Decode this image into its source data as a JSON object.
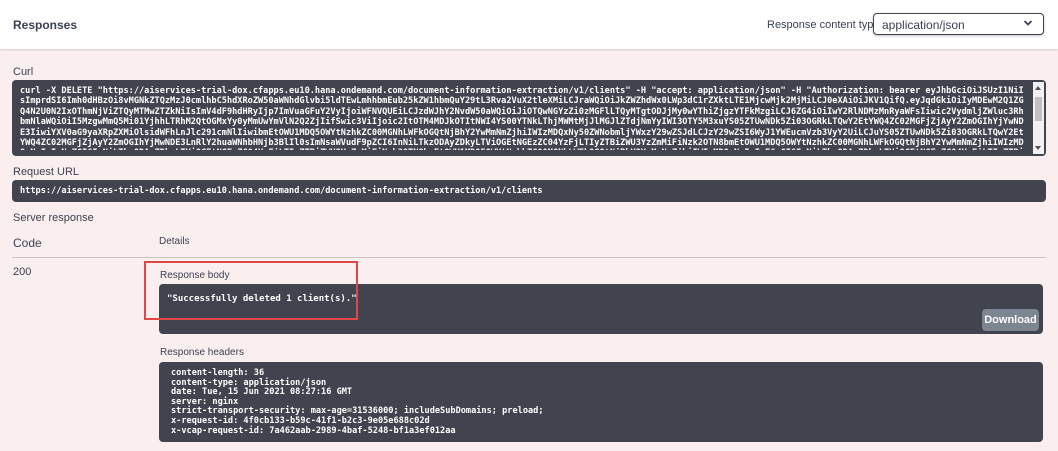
{
  "header": {
    "title": "Responses",
    "content_type_label": "Response content type",
    "content_type_value": "application/json"
  },
  "curl": {
    "label": "Curl",
    "command": "curl -X DELETE \"https://aiservices-trial-dox.cfapps.eu10.hana.ondemand.com/document-information-extraction/v1/clients\" -H \"accept: application/json\" -H \"Authorization: bearer eyJhbGciOiJSUzI1NiIsImprdSI6Imh0dHBzOi8vMGNkZTQzMzJ0cmlhbC5hdXRoZW50aWNhdGlvbi5ldTEwLmhhbmEub25kZW1hbmQuY29tL3Rva2VuX2tleXMiLCJraWQiOiJkZWZhdWx0LWp3dC1rZXktLTE1MjcwMjk2MjMiLCJ0eXAiOiJKV1QifQ.eyJqdGkiOiIyMDEwM2Q1ZGQ4N2U0N2IxOThmNjViZTQyMTMwZTZkNiIsImV4dF9hdHRyIjp7ImVuaGFuY2VyIjoiWFNVQUEiLCJzdWJhY2NvdW50aWQiOiJiOTQwNGYzZi0zMGFlLTQyMTgtODJjMy0wYThiZjgzYTFkMzgiLCJ6ZG4iOiIwY2RlNDMzMnRyaWFsIiwic2VydmljZWluc3RhbmNlaWQiOiI5MzgwMmQ5Mi01YjhhLTRhM2QtOGMxYy0yMmUwYmVlN2Q2ZjIifSwic3ViIjoic2ItOTM4MDJkOTItNWI4YS00YTNkLThjMWMtMjJlMGJlZTdjNmYyIWI3OTY5M3xuYS05ZTUwNDk5Zi03OGRkLTQwY2EtYWQ4ZC02MGFjZjAyY2ZmOGIhYjYwNDE3IiwiYXV0aG9yaXRpZXMiOlsidWFhLnJlc291cmNlIiwibmEtOWU1MDQ5OWYtNzhkZC00MGNhLWFkOGQtNjBhY2YwMmNmZjhiIWIzMDQxNy50ZWNobmljYWxzY29wZSJdLCJzY29wZSI6WyJ1YWEucmVzb3VyY2UiLCJuYS05ZTUwNDk5Zi03OGRkLTQwY2EtYWQ4ZC02MGFjZjAyY2ZmOGIhYjMwNDE3LnRlY2huaWNhbHNjb3BlIl0sImNsaWVudF9pZCI6InNiLTkzODAyZDkyLTViOGEtNGEzZC04YzFjLTIyZTBiZWU3YzZmMiFiNzk2OTN8bmEtOWU1MDQ5OWYtNzhkZC00MGNhLWFkOGQtNjBhY2YwMmNmZjhiIWIzMDQxNyIsImNpZCI6InNiLTkzODAyZDkyLTViOGEtNGEzZC04YzFjLTIyZTBiZWU3YzZmMiFiNzk2OTN8bmEtOWU1MDQ5OWYtNzhkZC00MGNhLWFkOGQtNjBhY2YwMmNmZjhiIWIzMDQxNyIsImF6cCI6InNiLTkzODAyZDkyLTViOGEtNGEzZC04YzFjLTIyZTBiZWU3YzZmMiFiNzk2OTN8bmEtOWU1MDQ5OWYtNzhkZC00MGNhLWFkOGQtNjBhY2YwMmNmZjhiIWIzMDQxNyIsImdyYW50X3R5cGUiOiJjbGllbnRfY3JlZGVudGlhbHMiLCJyZXZfc2lnIjoiZDJkZTBjMDIiLCJpYXQiOjE2MjM3NDI0MzYsImV4cCI6MTYyMzc4NTYzNiwiaXNzIjoiaHR0cHM6Ly8wY2RlNDMzMnRyaWFsLmF1dGhlbnRpY2F0aW9uLmV1MTAuaGFuYS5vbmRlbWFuZC5jb20vb2F1dGgvdG9rZW4i"
  },
  "request_url": {
    "label": "Request URL",
    "value": "https://aiservices-trial-dox.cfapps.eu10.hana.ondemand.com/document-information-extraction/v1/clients"
  },
  "server_response": {
    "label": "Server response",
    "code_header": "Code",
    "details_header": "Details",
    "code": "200",
    "body_label": "Response body",
    "body": "\"Successfully deleted 1 client(s).\"",
    "download_label": "Download",
    "headers_label": "Response headers",
    "headers": [
      "content-length: 36",
      "content-type: application/json",
      "date: Tue, 15 Jun 2021 08:27:16 GMT",
      "server: nginx",
      "strict-transport-security: max-age=31536000; includeSubDomains; preload;",
      "x-request-id: 4f0cb133-b59c-41f1-b2c3-9e05e688c02d",
      "x-vcap-request-id: 7a462aab-2989-4baf-5248-bf1a3ef012aa"
    ]
  },
  "colors": {
    "page_bg": "#fbeeef",
    "code_bg": "#41444e",
    "highlight": "#e04848",
    "download_bg": "#7d8492"
  }
}
